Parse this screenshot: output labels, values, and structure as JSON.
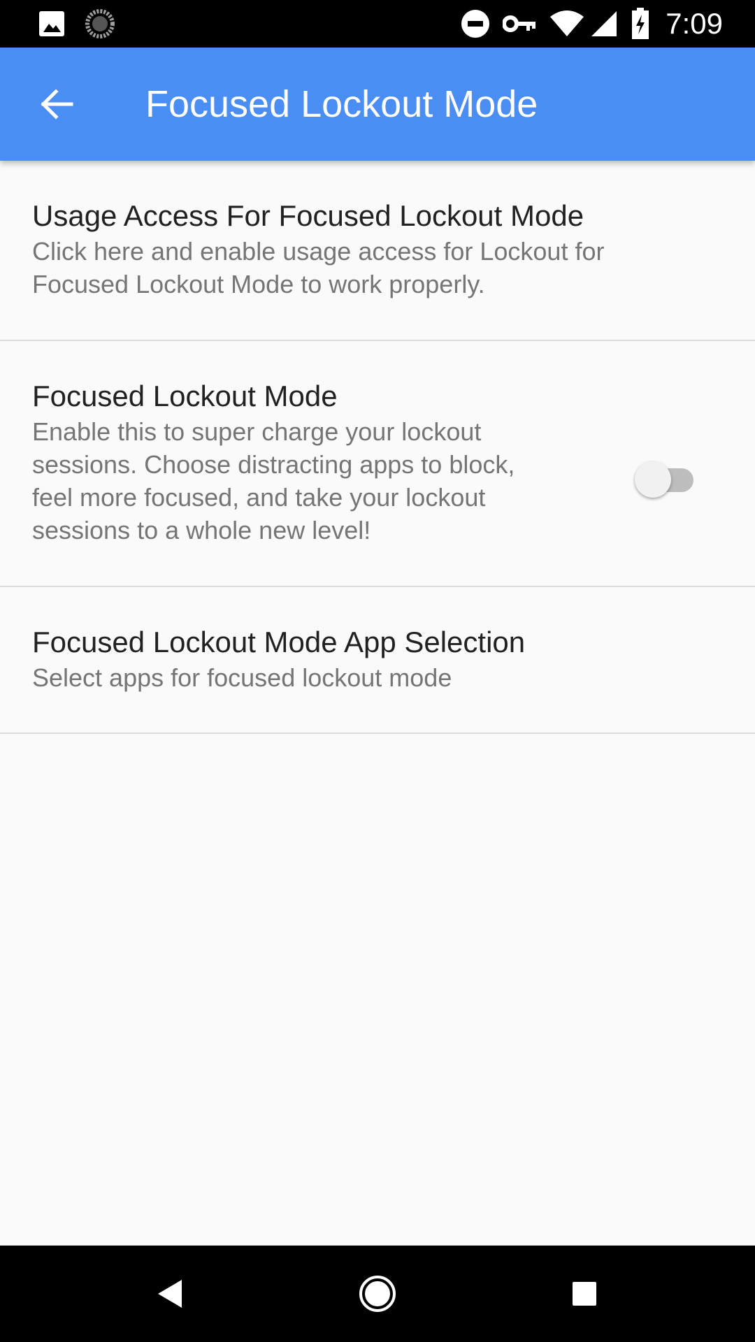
{
  "status_bar": {
    "time": "7:09",
    "icons": [
      "image-icon",
      "sync-icon",
      "do-not-disturb-icon",
      "vpn-key-icon",
      "wifi-icon",
      "signal-icon",
      "battery-charging-icon"
    ]
  },
  "app_bar": {
    "title": "Focused Lockout Mode",
    "back_icon": "arrow-back-icon",
    "color": "#4a8ef4"
  },
  "preferences": [
    {
      "title": "Usage Access For Focused Lockout Mode",
      "summary_lines": [
        "Click here and enable usage access for Lockout for",
        "Focused Lockout Mode to work properly."
      ]
    },
    {
      "title": "Focused Lockout Mode",
      "summary_lines": [
        "Enable this to super charge your lockout",
        "sessions. Choose distracting apps to block,",
        "feel more focused, and take your lockout",
        "sessions to a whole new level!"
      ],
      "toggle_on": false
    },
    {
      "title": "Focused Lockout Mode App Selection",
      "summary_lines": [
        "Select apps for focused lockout mode"
      ]
    }
  ],
  "nav_bar": {
    "icons": [
      "back-triangle-icon",
      "home-circle-icon",
      "recents-square-icon"
    ]
  }
}
